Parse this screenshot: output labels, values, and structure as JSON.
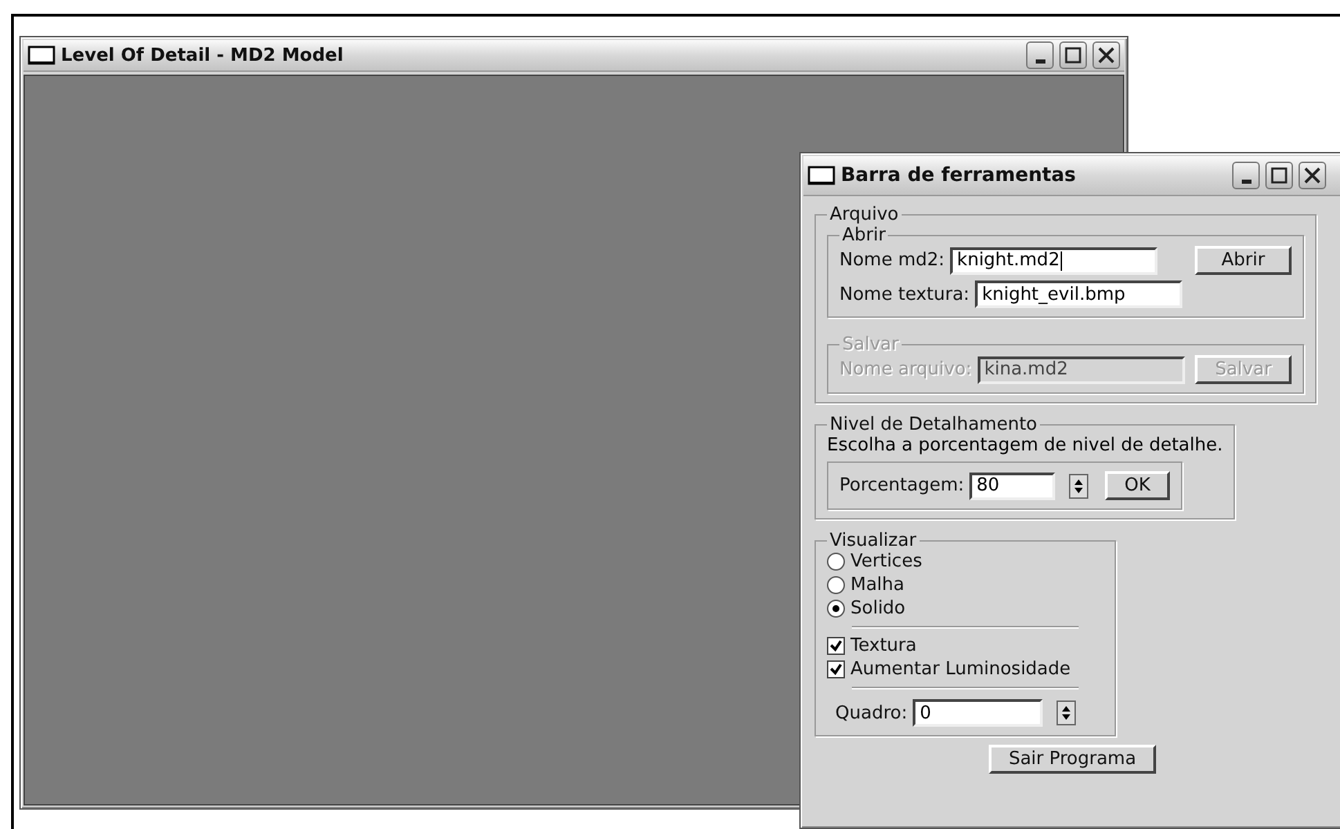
{
  "main_window": {
    "title": "Level Of Detail - MD2 Model"
  },
  "toolbar_window": {
    "title": "Barra de ferramentas",
    "arquivo": {
      "title": "Arquivo",
      "groups": [
        {
          "title": "Abrir",
          "disabled": false,
          "rows": [
            {
              "label": "Nome md2:",
              "value": "knight.md2",
              "button": "Abrir",
              "focused": true
            },
            {
              "label": "Nome textura:",
              "value": "knight_evil.bmp",
              "focused": false
            }
          ]
        },
        {
          "title": "Salvar",
          "disabled": true,
          "rows": [
            {
              "label": "Nome arquivo:",
              "value": "kina.md2",
              "button": "Salvar",
              "focused": false
            }
          ]
        }
      ]
    },
    "nivel": {
      "title": "Nivel de Detalhamento",
      "description": "Escolha a porcentagem de nivel de detalhe.",
      "spin_label": "Porcentagem:",
      "spin_value": "80",
      "button": "OK"
    },
    "visualizar": {
      "title": "Visualizar",
      "options": [
        {
          "label": "Vertices",
          "selected": false
        },
        {
          "label": "Malha",
          "selected": false
        },
        {
          "label": "Solido",
          "selected": true
        }
      ],
      "checks": [
        {
          "label": "Textura",
          "checked": true
        },
        {
          "label": "Aumentar Luminosidade",
          "checked": true
        }
      ],
      "frame_label": "Quadro:",
      "frame_value": "0"
    },
    "exit_button": "Sair Programa"
  }
}
